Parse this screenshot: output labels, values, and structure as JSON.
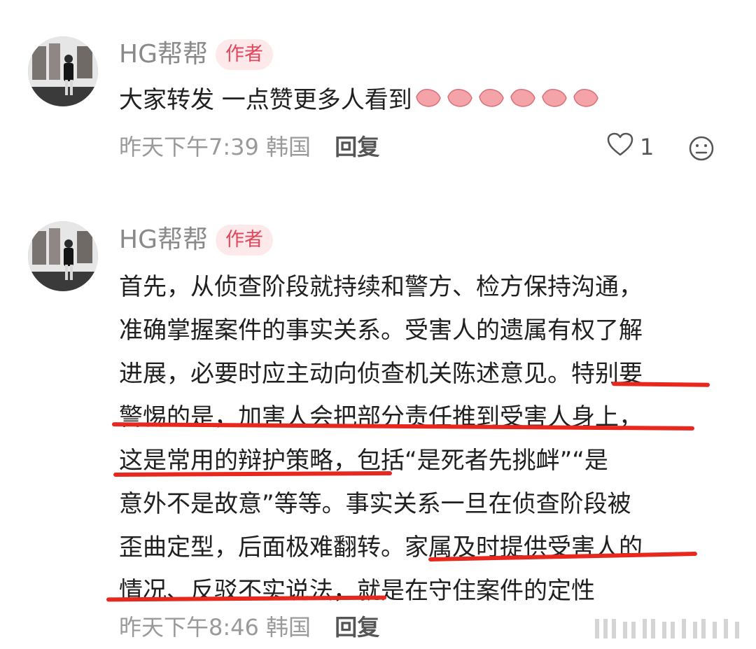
{
  "comments": [
    {
      "username": "HG帮帮",
      "badge": "作者",
      "text_lines": [
        "大家转发 一点赞更多人看到"
      ],
      "emoji_name": "clapping-hands-icon",
      "timestamp": "昨天下午7:39",
      "location": "韩国",
      "reply_label": "回复",
      "like_count": "1"
    },
    {
      "username": "HG帮帮",
      "badge": "作者",
      "text_lines": [
        "首先，从侦查阶段就持续和警方、检方保持沟通，",
        "准确掌握案件的事实关系。受害人的遗属有权了解",
        "进展，必要时应主动向侦查机关陈述意见。特别要",
        "警惕的是，加害人会把部分责任推到受害人身上，",
        "这是常用的辩护策略，包括“是死者先挑衅”“是",
        "意外不是故意”等等。事实关系一旦在侦查阶段被",
        "歪曲定型，后面极难翻转。家属及时提供受害人的",
        "情况、反驳不实说法，就是在守住案件的定性"
      ],
      "timestamp": "昨天下午8:46",
      "location": "韩国",
      "reply_label": "回复"
    }
  ],
  "colors": {
    "accent_badge_bg": "#fde8ea",
    "accent_badge_text": "#e0475d",
    "underline": "#e8271e"
  },
  "icons": [
    "heart-icon",
    "emoji-face-icon",
    "clapping-hands-icon"
  ]
}
